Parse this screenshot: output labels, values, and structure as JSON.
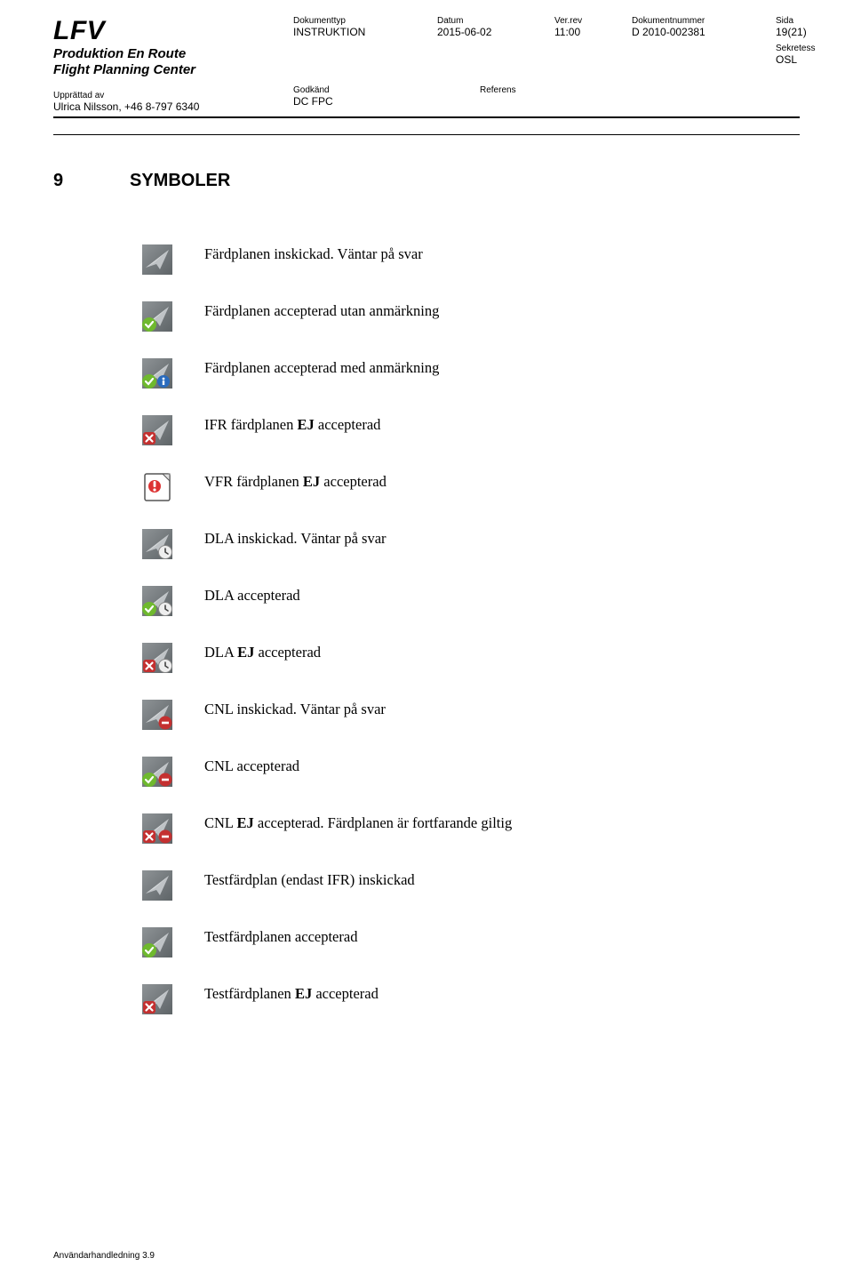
{
  "header": {
    "brand": "LFV",
    "sub1": "Produktion En Route",
    "sub2": "Flight Planning Center",
    "author_label": "Upprättad av",
    "author_value": "Ulrica Nilsson, +46 8-797 6340",
    "approved_label": "Godkänd",
    "approved_value": "DC FPC",
    "reference_label": "Referens",
    "cols": {
      "doctype_label": "Dokumenttyp",
      "doctype_value": "INSTRUKTION",
      "date_label": "Datum",
      "date_value": "2015-06-02",
      "ver_label": "Ver.rev",
      "ver_value": "11:00",
      "docnum_label": "Dokumentnummer",
      "docnum_value": "D 2010-002381",
      "page_label": "Sida",
      "page_value": "19(21)",
      "sekretess_label": "Sekretess",
      "sekretess_value": "OSL"
    }
  },
  "section": {
    "num": "9",
    "title": "SYMBOLER"
  },
  "symbols": [
    {
      "text": "Färdplanen inskickad. Väntar på svar"
    },
    {
      "text": "Färdplanen accepterad utan anmärkning"
    },
    {
      "text": "Färdplanen accepterad med anmärkning"
    },
    {
      "html": "IFR färdplanen <b>EJ</b> accepterad"
    },
    {
      "html": "VFR färdplanen <b>EJ</b> accepterad"
    },
    {
      "text": "DLA inskickad. Väntar på svar"
    },
    {
      "text": "DLA accepterad"
    },
    {
      "html": "DLA <b>EJ</b> accepterad"
    },
    {
      "text": "CNL inskickad. Väntar på svar"
    },
    {
      "text": "CNL accepterad"
    },
    {
      "html": "CNL <b>EJ</b> accepterad. Färdplanen är fortfarande giltig"
    },
    {
      "text": "Testfärdplan (endast IFR)  inskickad"
    },
    {
      "text": "Testfärdplanen accepterad"
    },
    {
      "html": "Testfärdplanen <b>EJ</b> accepterad"
    }
  ],
  "footer": "Användarhandledning 3.9"
}
